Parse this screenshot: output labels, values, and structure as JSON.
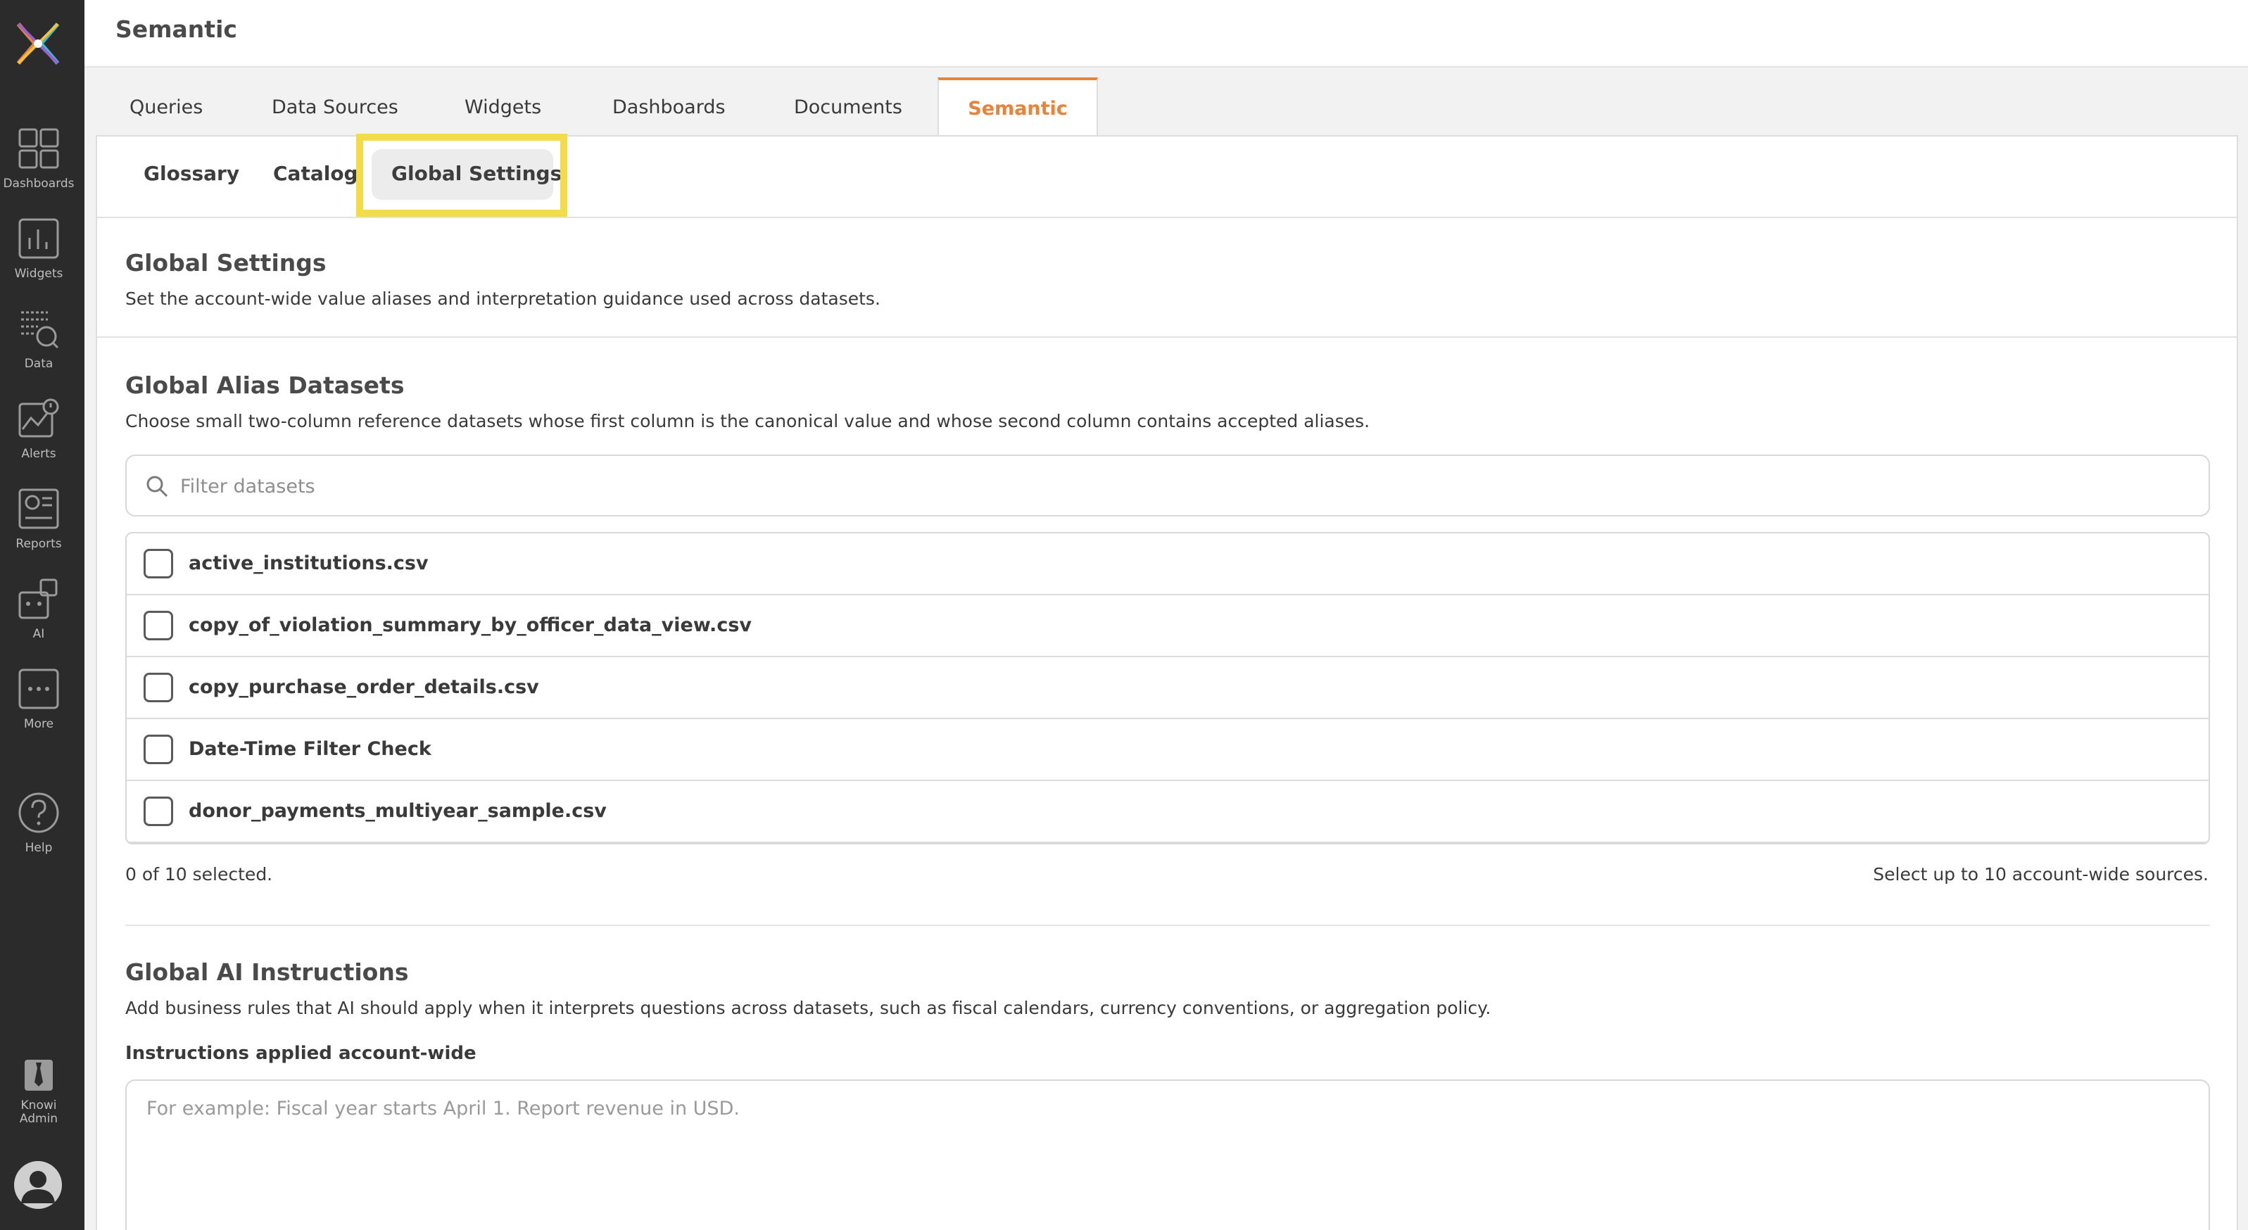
{
  "header": {
    "title": "Semantic"
  },
  "sidebar": {
    "items": [
      {
        "label": "Dashboards",
        "icon": "dashboards-icon"
      },
      {
        "label": "Widgets",
        "icon": "widgets-icon"
      },
      {
        "label": "Data",
        "icon": "data-icon"
      },
      {
        "label": "Alerts",
        "icon": "alerts-icon"
      },
      {
        "label": "Reports",
        "icon": "reports-icon"
      },
      {
        "label": "AI",
        "icon": "ai-icon"
      },
      {
        "label": "More",
        "icon": "more-icon"
      },
      {
        "label": "Help",
        "icon": "help-icon"
      },
      {
        "label": "Knowi Admin",
        "icon": "admin-icon"
      }
    ]
  },
  "main_tabs": [
    {
      "label": "Queries"
    },
    {
      "label": "Data Sources"
    },
    {
      "label": "Widgets"
    },
    {
      "label": "Dashboards"
    },
    {
      "label": "Documents"
    },
    {
      "label": "Semantic",
      "active": true
    }
  ],
  "sub_tabs": [
    {
      "label": "Glossary"
    },
    {
      "label": "Catalog"
    },
    {
      "label": "Global Settings",
      "active": true
    }
  ],
  "global_settings": {
    "title": "Global Settings",
    "description": "Set the account-wide value aliases and interpretation guidance used across datasets."
  },
  "alias": {
    "title": "Global Alias Datasets",
    "description": "Choose small two-column reference datasets whose first column is the canonical value and whose second column contains accepted aliases.",
    "filter_placeholder": "Filter datasets",
    "datasets": [
      {
        "name": "active_institutions.csv",
        "checked": false
      },
      {
        "name": "copy_of_violation_summary_by_officer_data_view.csv",
        "checked": false
      },
      {
        "name": "copy_purchase_order_details.csv",
        "checked": false
      },
      {
        "name": "Date-Time Filter Check",
        "checked": false
      },
      {
        "name": "donor_payments_multiyear_sample.csv",
        "checked": false
      }
    ],
    "selected_count": "0 of 10 selected.",
    "limit_note": "Select up to 10 account-wide sources."
  },
  "ai": {
    "title": "Global AI Instructions",
    "description": "Add business rules that AI should apply when it interprets questions across datasets, such as fiscal calendars, currency conventions, or aggregation policy.",
    "instructions_label": "Instructions applied account-wide",
    "instructions_placeholder": "For example: Fiscal year starts April 1. Report revenue in USD.",
    "instructions_value": ""
  },
  "colors": {
    "sidebar_bg": "#2b2b2b",
    "accent": "#e8833a",
    "highlight": "#f3dc4c"
  }
}
